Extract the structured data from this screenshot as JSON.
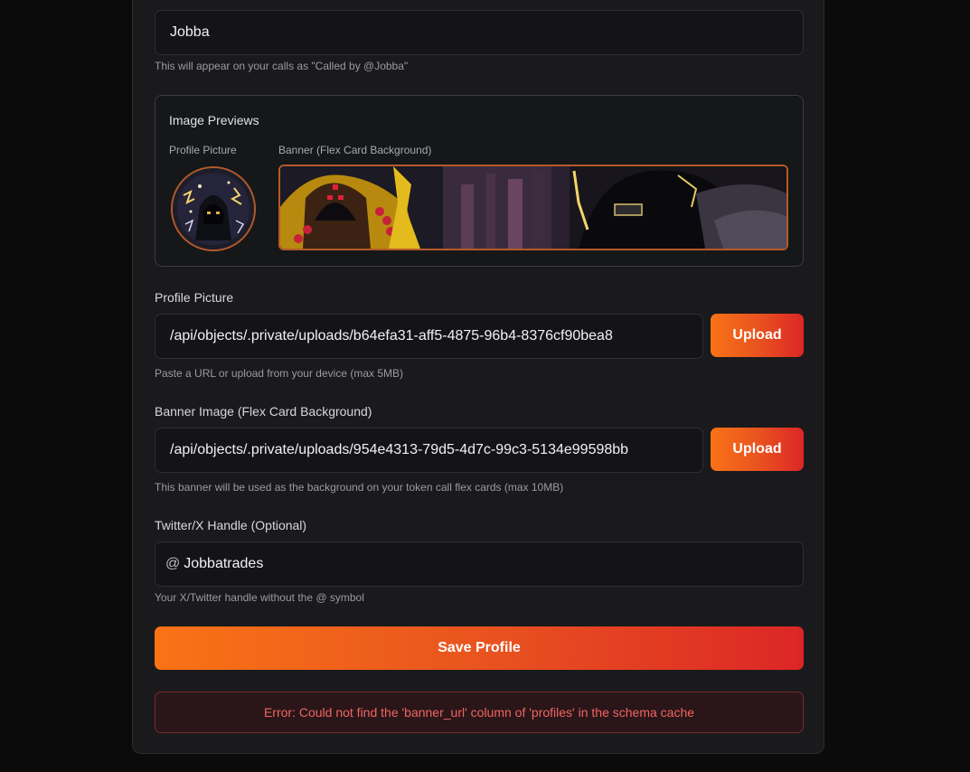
{
  "display_name": {
    "value": "Jobba",
    "help": "This will appear on your calls as \"Called by @Jobba\""
  },
  "previews": {
    "title": "Image Previews",
    "profile_label": "Profile Picture",
    "banner_label": "Banner (Flex Card Background)"
  },
  "profile_picture": {
    "label": "Profile Picture",
    "value": "/api/objects/.private/uploads/b64efa31-aff5-4875-96b4-8376cf90bea8",
    "upload_label": "Upload",
    "help": "Paste a URL or upload from your device (max 5MB)"
  },
  "banner_image": {
    "label": "Banner Image (Flex Card Background)",
    "value": "/api/objects/.private/uploads/954e4313-79d5-4d7c-99c3-5134e99598bb",
    "upload_label": "Upload",
    "help": "This banner will be used as the background on your token call flex cards (max 10MB)"
  },
  "twitter": {
    "label": "Twitter/X Handle (Optional)",
    "prefix": "@",
    "value": "Jobbatrades",
    "help": "Your X/Twitter handle without the @ symbol"
  },
  "save_label": "Save Profile",
  "error": "Error: Could not find the 'banner_url' column of 'profiles' in the schema cache",
  "colors": {
    "accent_start": "#f97316",
    "accent_end": "#dc2626",
    "error_text": "#f16464"
  }
}
